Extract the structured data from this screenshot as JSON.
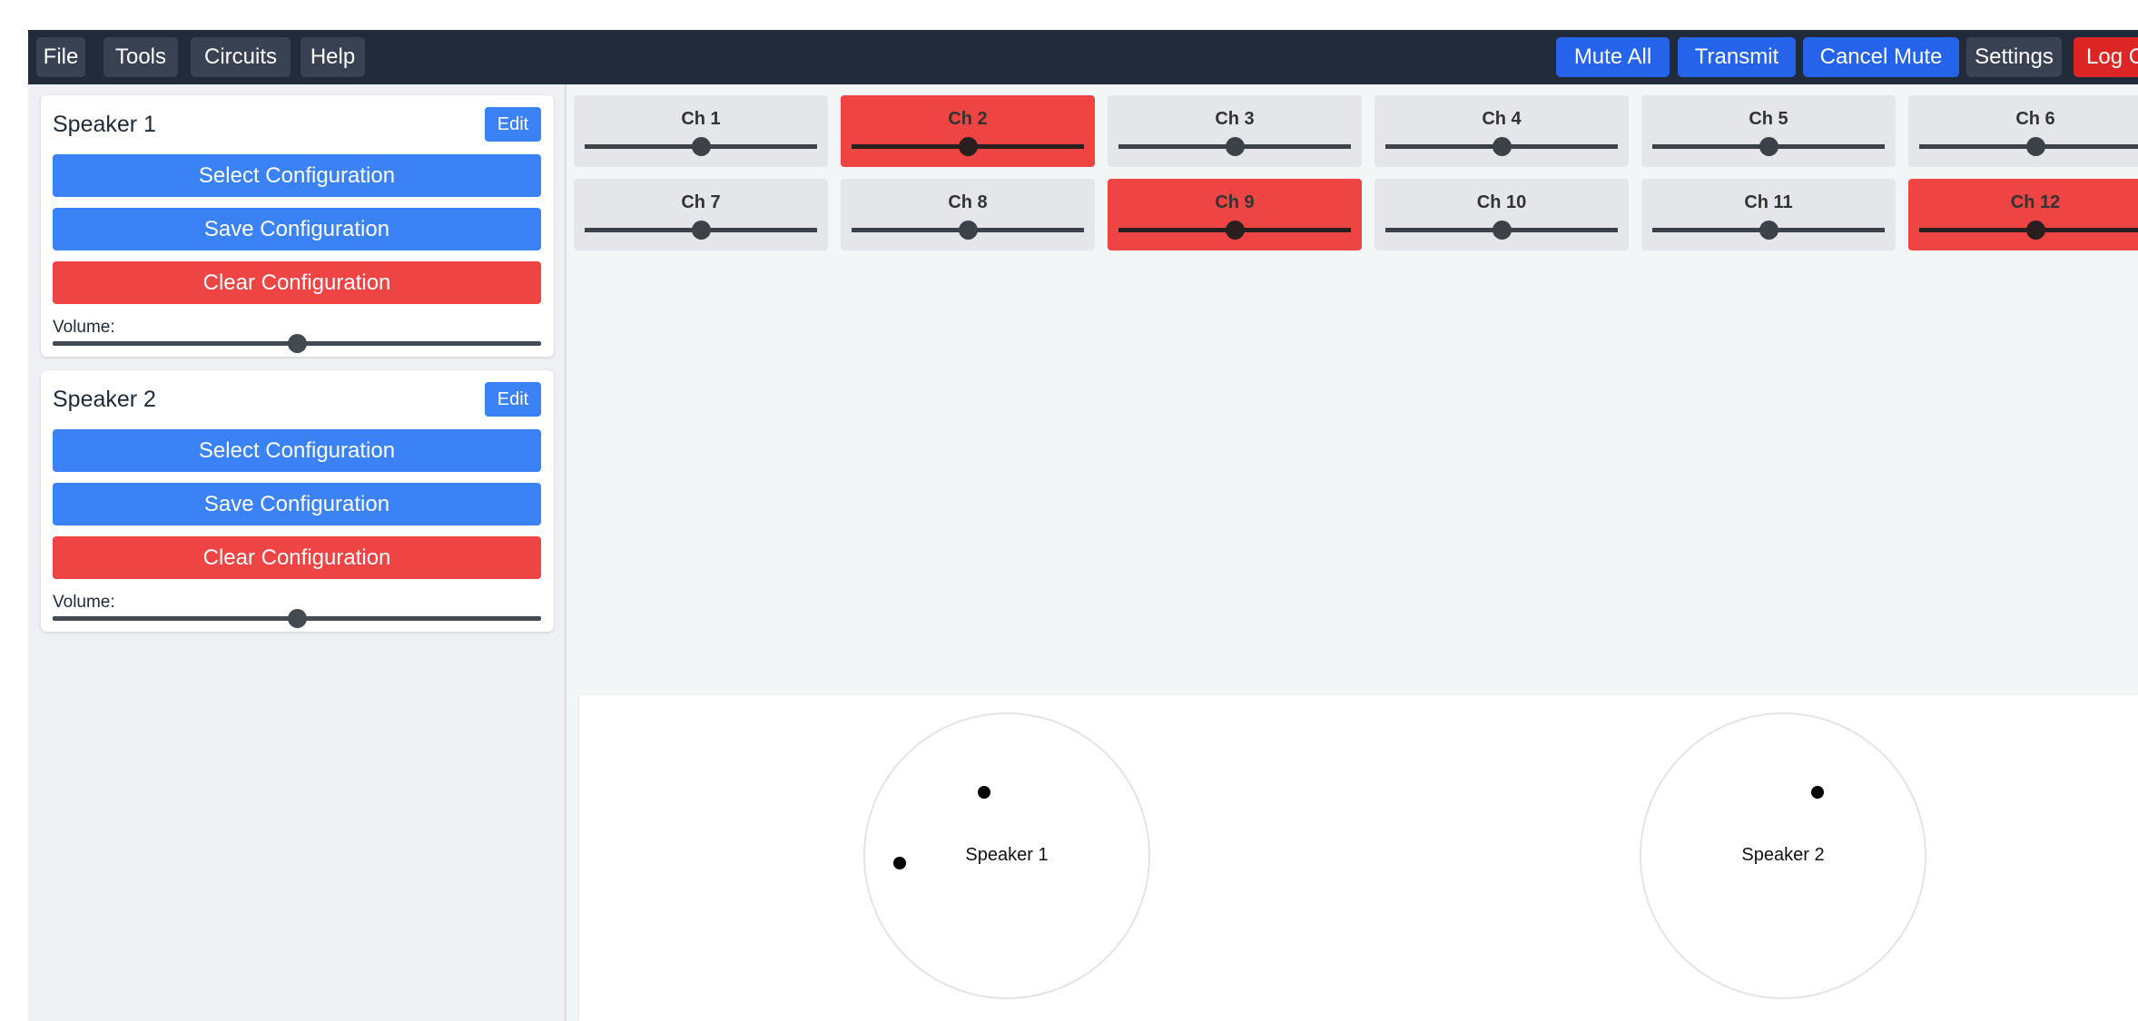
{
  "menu": {
    "items": [
      "File",
      "Tools",
      "Circuits",
      "Help"
    ]
  },
  "toolbar": {
    "mute_all": "Mute All",
    "transmit": "Transmit",
    "cancel_mute": "Cancel Mute",
    "settings": "Settings",
    "logout": "Log Out"
  },
  "speakers": [
    {
      "title": "Speaker 1",
      "edit": "Edit",
      "select": "Select Configuration",
      "save": "Save Configuration",
      "clear": "Clear Configuration",
      "volume_label": "Volume:",
      "volume_fraction": 0.5
    },
    {
      "title": "Speaker 2",
      "edit": "Edit",
      "select": "Select Configuration",
      "save": "Save Configuration",
      "clear": "Clear Configuration",
      "volume_label": "Volume:",
      "volume_fraction": 0.5
    }
  ],
  "channels": [
    {
      "label": "Ch 1",
      "active": false,
      "level": 0.5
    },
    {
      "label": "Ch 2",
      "active": true,
      "level": 0.5
    },
    {
      "label": "Ch 3",
      "active": false,
      "level": 0.5
    },
    {
      "label": "Ch 4",
      "active": false,
      "level": 0.5
    },
    {
      "label": "Ch 5",
      "active": false,
      "level": 0.5
    },
    {
      "label": "Ch 6",
      "active": false,
      "level": 0.5
    },
    {
      "label": "Ch 7",
      "active": false,
      "level": 0.5
    },
    {
      "label": "Ch 8",
      "active": false,
      "level": 0.5
    },
    {
      "label": "Ch 9",
      "active": true,
      "level": 0.5
    },
    {
      "label": "Ch 10",
      "active": false,
      "level": 0.5
    },
    {
      "label": "Ch 11",
      "active": false,
      "level": 0.5
    },
    {
      "label": "Ch 12",
      "active": true,
      "level": 0.5
    }
  ],
  "layout_speakers": [
    {
      "label": "Speaker 1"
    },
    {
      "label": "Speaker 2"
    }
  ],
  "colors": {
    "primary": "#3b82f6",
    "toolbar_blue": "#2563eb",
    "danger": "#ef4444",
    "logout": "#dc2626",
    "channel_idle": "#e4e6e9",
    "channel_active": "#ef4444",
    "topbar": "#222b3a"
  }
}
